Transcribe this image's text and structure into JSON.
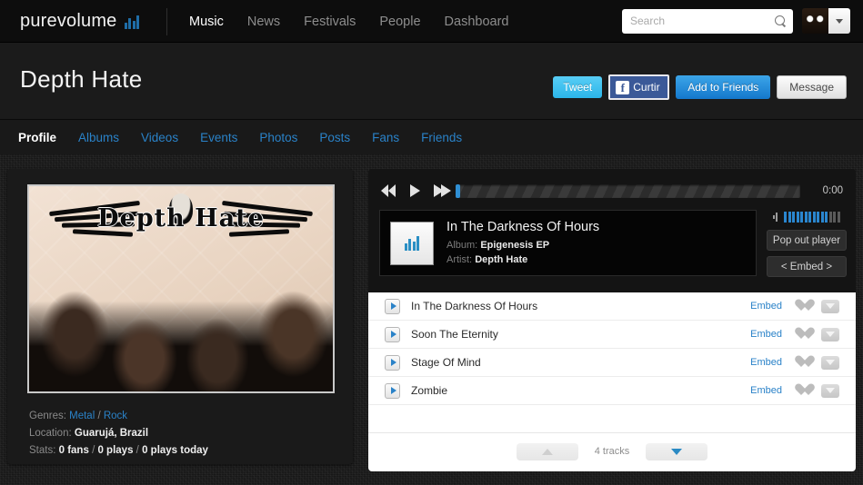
{
  "topnav": {
    "brand": "purevolume",
    "brand_icon": "bar-chart-icon",
    "links": [
      {
        "label": "Music",
        "active": true
      },
      {
        "label": "News",
        "active": false
      },
      {
        "label": "Festivals",
        "active": false
      },
      {
        "label": "People",
        "active": false
      },
      {
        "label": "Dashboard",
        "active": false
      }
    ],
    "search": {
      "value": "",
      "placeholder": "Search",
      "icon": "search-icon"
    },
    "account": {
      "avatar": "user-avatar",
      "caret": "chevron-down-icon"
    }
  },
  "artist": {
    "name": "Depth Hate",
    "buttons": {
      "tweet": "Tweet",
      "facebook": "Curtir",
      "facebook_icon": "facebook-icon",
      "add_to_friends": "Add to Friends",
      "message": "Message"
    }
  },
  "tabs": [
    {
      "label": "Profile",
      "active": true
    },
    {
      "label": "Albums",
      "active": false
    },
    {
      "label": "Videos",
      "active": false
    },
    {
      "label": "Events",
      "active": false
    },
    {
      "label": "Photos",
      "active": false
    },
    {
      "label": "Posts",
      "active": false
    },
    {
      "label": "Fans",
      "active": false
    },
    {
      "label": "Friends",
      "active": false
    }
  ],
  "profile": {
    "photo_alt": "Depth Hate band photo with winged logo",
    "logo_text": "Depth Hate",
    "genres_label": "Genres:",
    "genres": [
      "Metal",
      "Rock"
    ],
    "genres_separator": "/",
    "location_label": "Location:",
    "location": "Guarujá, Brazil",
    "stats_label": "Stats:",
    "stats_fans": "0 fans",
    "stats_plays": "0 plays",
    "stats_plays_today": "0 plays today"
  },
  "player": {
    "prev_icon": "rewind-icon",
    "play_icon": "play-icon",
    "next_icon": "fast-forward-icon",
    "progress_percent": 0,
    "time": "0:00",
    "now_playing": {
      "title": "In The Darkness Of Hours",
      "album_label": "Album:",
      "album": "Epigenesis EP",
      "artist_label": "Artist:",
      "artist": "Depth Hate",
      "art_icon": "bar-chart-icon"
    },
    "volume": {
      "icon": "speaker-icon",
      "level": 11,
      "total": 14
    },
    "pop_out_label": "Pop out player",
    "embed_label": "< Embed >"
  },
  "tracklist": {
    "tracks": [
      {
        "title": "In The Darkness Of Hours",
        "embed": "Embed"
      },
      {
        "title": "Soon The Eternity",
        "embed": "Embed"
      },
      {
        "title": "Stage Of Mind",
        "embed": "Embed"
      },
      {
        "title": "Zombie",
        "embed": "Embed"
      }
    ],
    "count_label": "4 tracks",
    "prev_page_icon": "triangle-up-icon",
    "next_page_icon": "triangle-down-icon",
    "heart_icon": "heart-icon",
    "download_icon": "download-icon",
    "play_icon": "play-icon"
  },
  "colors": {
    "accent_blue": "#2a82c8",
    "facebook_blue": "#3b5998",
    "twitter_blue": "#2bb6ea",
    "page_bg": "#171717",
    "panel_bg": "#1a1a1a"
  }
}
